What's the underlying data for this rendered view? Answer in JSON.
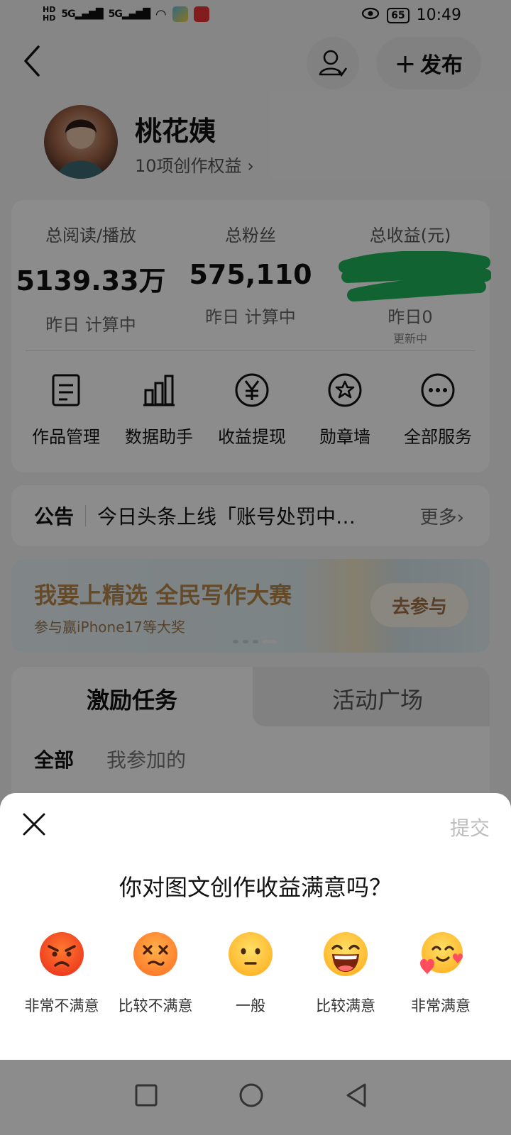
{
  "status_bar": {
    "time": "10:49",
    "battery": "65",
    "network_1": "5G",
    "network_2": "5G",
    "hd_1": "HD",
    "hd_2": "HD"
  },
  "header": {
    "publish_label": "发布"
  },
  "profile": {
    "name": "桃花姨",
    "rights": "10项创作权益",
    "rights_chevron": "›"
  },
  "stats": [
    {
      "label": "总阅读/播放",
      "value": "5139.33万",
      "sub": "昨日 计算中"
    },
    {
      "label": "总粉丝",
      "value": "575,110",
      "sub": "昨日 计算中"
    },
    {
      "label": "总收益(元)",
      "value": "",
      "sub": "昨日0",
      "updating": "更新中"
    }
  ],
  "services": [
    {
      "label": "作品管理",
      "icon": "document-icon"
    },
    {
      "label": "数据助手",
      "icon": "bar-chart-icon"
    },
    {
      "label": "收益提现",
      "icon": "yuan-icon"
    },
    {
      "label": "勋章墙",
      "icon": "medal-icon"
    },
    {
      "label": "全部服务",
      "icon": "more-icon"
    }
  ],
  "notice": {
    "tag": "公告",
    "text": "今日头条上线「账号处罚中…",
    "more": "更多›"
  },
  "banner": {
    "title": "我要上精选 全民写作大赛",
    "subtitle": "参与赢iPhone17等大奖",
    "button": "去参与"
  },
  "tasks": {
    "tab_active": "激励任务",
    "tab_inactive": "活动广场",
    "filter_all": "全部",
    "filter_mine": "我参加的"
  },
  "survey": {
    "submit": "提交",
    "question": "你对图文创作收益满意吗？",
    "options": [
      {
        "label": "非常不满意",
        "icon": "angry-face-icon"
      },
      {
        "label": "比较不满意",
        "icon": "dizzy-face-icon"
      },
      {
        "label": "一般",
        "icon": "neutral-face-icon"
      },
      {
        "label": "比较满意",
        "icon": "laughing-face-icon"
      },
      {
        "label": "非常满意",
        "icon": "smiling-hearts-face-icon"
      }
    ]
  },
  "colors": {
    "accent_gold": "#b8874b",
    "face_yellow": "#ffc93a",
    "face_orange": "#ff7a30",
    "scribble_green": "#1fb45a"
  }
}
